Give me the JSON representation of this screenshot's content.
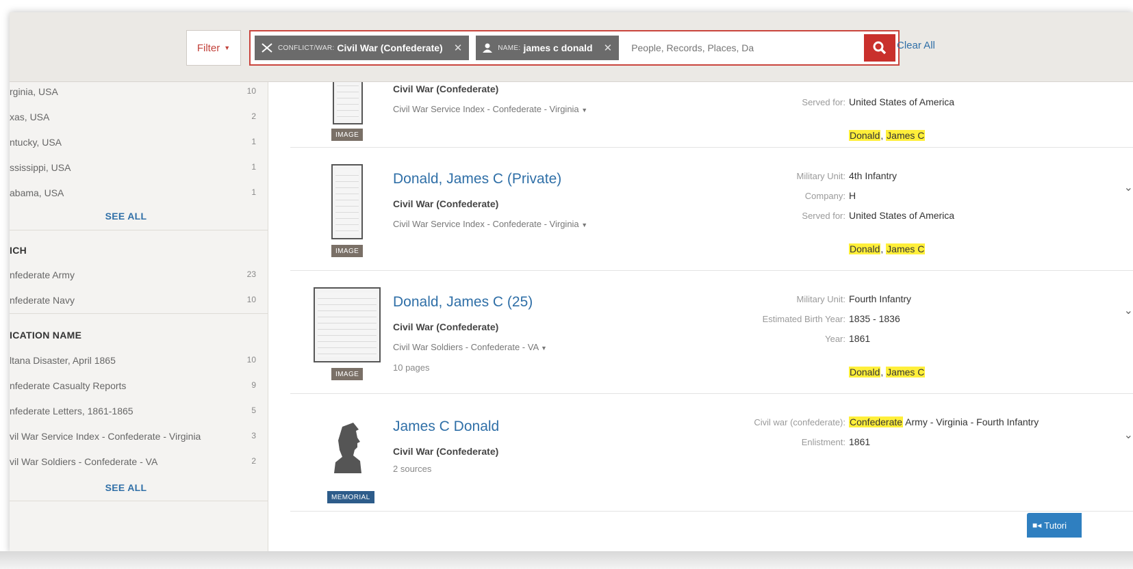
{
  "header": {
    "filter_label": "Filter",
    "chips": [
      {
        "key": "CONFLICT/WAR:",
        "value": "Civil War (Confederate)"
      },
      {
        "key": "NAME:",
        "value": "james c donald"
      }
    ],
    "search_placeholder": "People, Records, Places, Da",
    "clear_all": "Clear All"
  },
  "sidebar": {
    "locations": [
      {
        "label": "rginia, USA",
        "count": "10"
      },
      {
        "label": "xas, USA",
        "count": "2"
      },
      {
        "label": "ntucky, USA",
        "count": "1"
      },
      {
        "label": "ssissippi, USA",
        "count": "1"
      },
      {
        "label": "abama, USA",
        "count": "1"
      }
    ],
    "see_all_1": "SEE ALL",
    "branch_heading": "ICH",
    "branches": [
      {
        "label": "nfederate Army",
        "count": "23"
      },
      {
        "label": "nfederate Navy",
        "count": "10"
      }
    ],
    "publication_heading": "ICATION NAME",
    "publications": [
      {
        "label": "ltana Disaster, April 1865",
        "count": "10"
      },
      {
        "label": "nfederate Casualty Reports",
        "count": "9"
      },
      {
        "label": "nfederate Letters, 1861-1865",
        "count": "5"
      },
      {
        "label": "vil War Service Index - Confederate - Virginia",
        "count": "3"
      },
      {
        "label": "vil War Soldiers - Confederate - VA",
        "count": "2"
      }
    ],
    "see_all_2": "SEE ALL"
  },
  "results": [
    {
      "tag": "IMAGE",
      "subtitle": "Civil War (Confederate)",
      "collection": "Civil War Service Index - Confederate - Virginia",
      "fields": [
        {
          "key": "Served for:",
          "value": "United States of America"
        }
      ],
      "highlight": [
        "Donald",
        "James C"
      ]
    },
    {
      "tag": "IMAGE",
      "title": "Donald, James C (Private)",
      "subtitle": "Civil War (Confederate)",
      "collection": "Civil War Service Index - Confederate - Virginia",
      "fields": [
        {
          "key": "Military Unit:",
          "value": "4th Infantry"
        },
        {
          "key": "Company:",
          "value": "H"
        },
        {
          "key": "Served for:",
          "value": "United States of America"
        }
      ],
      "highlight": [
        "Donald",
        "James C"
      ]
    },
    {
      "tag": "IMAGE",
      "title": "Donald, James C (25)",
      "subtitle": "Civil War (Confederate)",
      "collection": "Civil War Soldiers - Confederate - VA",
      "extra": "10 pages",
      "fields": [
        {
          "key": "Military Unit:",
          "value": "Fourth Infantry"
        },
        {
          "key": "Estimated Birth Year:",
          "value": "1835 - 1836"
        },
        {
          "key": "Year:",
          "value": "1861"
        }
      ],
      "highlight": [
        "Donald",
        "James C"
      ]
    },
    {
      "tag": "MEMORIAL",
      "title": "James C Donald",
      "subtitle": "Civil War (Confederate)",
      "extra": "2 sources",
      "fields": [
        {
          "key": "Civil war (confederate):",
          "value_highlight": "Confederate",
          "value_rest": " Army - Virginia - Fourth Infantry"
        },
        {
          "key": "Enlistment:",
          "value": "1861"
        }
      ]
    }
  ],
  "tutorial_label": "Tutori",
  "colors": {
    "accent": "#c9302c",
    "link": "#2f6fa7",
    "highlight": "#ffef3a",
    "chip": "#6b6b6b"
  }
}
